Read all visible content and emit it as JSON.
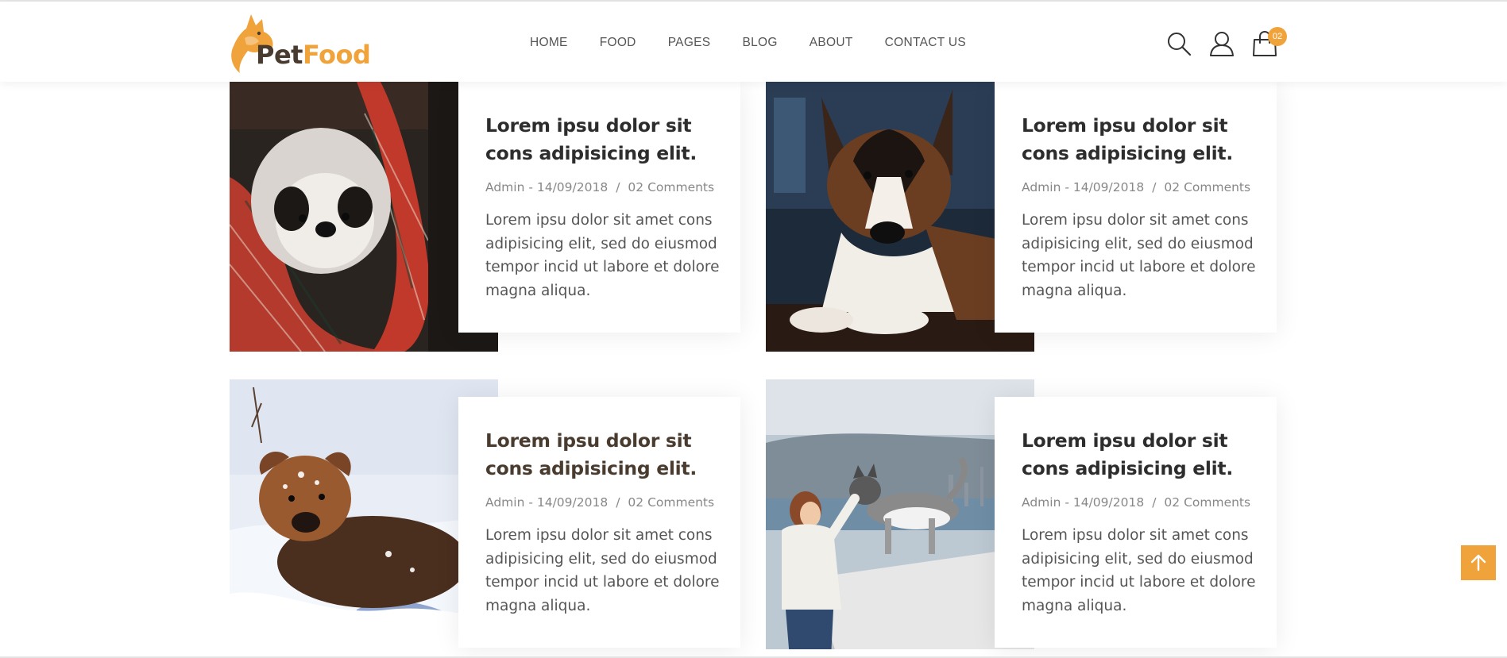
{
  "brand": {
    "name_part1": "Pet",
    "name_part2": "Food"
  },
  "colors": {
    "accent": "#f0a33a",
    "brand_dark": "#4a3b2f",
    "text": "#555555",
    "meta": "#888888"
  },
  "nav": {
    "items": [
      {
        "label": "HOME"
      },
      {
        "label": "FOOD"
      },
      {
        "label": "PAGES"
      },
      {
        "label": "BLOG"
      },
      {
        "label": "ABOUT"
      },
      {
        "label": "CONTACT US"
      }
    ]
  },
  "header_icons": {
    "search": "search-icon",
    "account": "user-icon",
    "cart": "shopping-bag-icon"
  },
  "cart": {
    "count": "02"
  },
  "posts": [
    {
      "image": "puppy in plaid pet carrier",
      "title": "Lorem ipsu dolor sit cons adipisicing elit.",
      "author_date": "Admin - 14/09/2018",
      "separator": "/",
      "comments": "02 Comments",
      "excerpt": "Lorem ipsu dolor sit amet cons adipisicing elit, sed do eiusmod tempor incid ut labore et dolore magna aliqua."
    },
    {
      "image": "corgi lying on the floor",
      "title": "Lorem ipsu dolor sit cons adipisicing elit.",
      "author_date": "Admin - 14/09/2018",
      "separator": "/",
      "comments": "02 Comments",
      "excerpt": "Lorem ipsu dolor sit amet cons adipisicing elit, sed do eiusmod tempor incid ut labore et dolore magna aliqua."
    },
    {
      "image": "dog playing in snow",
      "title": "Lorem ipsu dolor sit cons adipisicing elit.",
      "author_date": "Admin - 14/09/2018",
      "separator": "/",
      "comments": "02 Comments",
      "excerpt": "Lorem ipsu dolor sit amet cons adipisicing elit, sed do eiusmod tempor incid ut labore et dolore magna aliqua."
    },
    {
      "image": "woman with husky by the sea",
      "title": "Lorem ipsu dolor sit cons adipisicing elit.",
      "author_date": "Admin - 14/09/2018",
      "separator": "/",
      "comments": "02 Comments",
      "excerpt": "Lorem ipsu dolor sit amet cons adipisicing elit, sed do eiusmod tempor incid ut labore et dolore magna aliqua."
    }
  ],
  "scroll_top_icon": "arrow-up-icon"
}
